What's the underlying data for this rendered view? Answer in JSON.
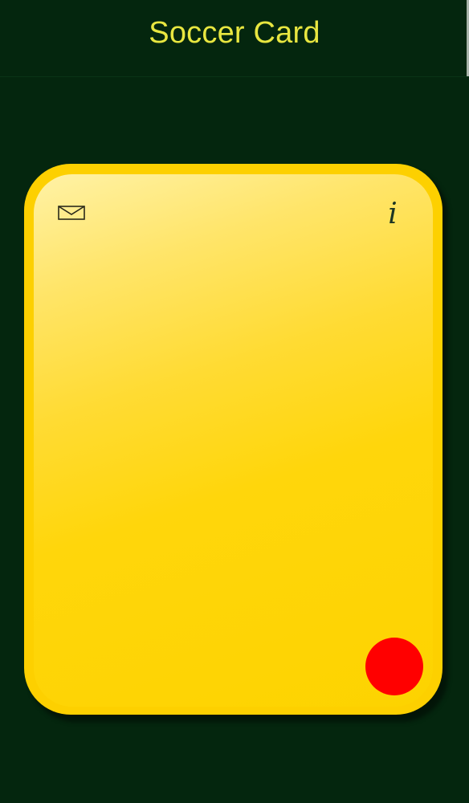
{
  "header": {
    "title": "Soccer Card"
  },
  "card": {
    "color_name": "yellow",
    "accent_color": "#fdd000",
    "mail_icon": "envelope-icon",
    "info_label": "i",
    "info_icon": "info-icon",
    "action_button_color": "#ff0000"
  },
  "colors": {
    "background": "#04260e",
    "title_text": "#e8e640"
  }
}
